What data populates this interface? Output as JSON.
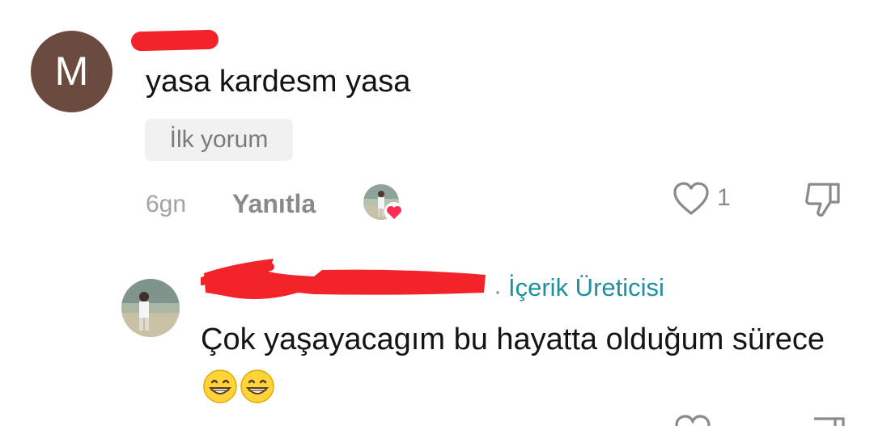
{
  "comment": {
    "avatar_letter": "M",
    "text": "yasa kardesm yasa",
    "badge": "İlk yorum",
    "time": "6gn",
    "reply_label": "Yanıtla",
    "like_count": "1"
  },
  "reply": {
    "separator": "·",
    "creator_label": "İçerik Üreticisi",
    "text": "Çok yaşayacagım bu hayatta olduğum sürece",
    "emojis": [
      "grinning-face",
      "grinning-face"
    ]
  },
  "colors": {
    "avatar_bg": "#6b4a3f",
    "redaction": "#f2242a",
    "creator_label": "#1f8fa1",
    "muted_text": "#8a8a8a",
    "badge_bg": "#f1f1f2",
    "heart": "#fe2c55"
  }
}
